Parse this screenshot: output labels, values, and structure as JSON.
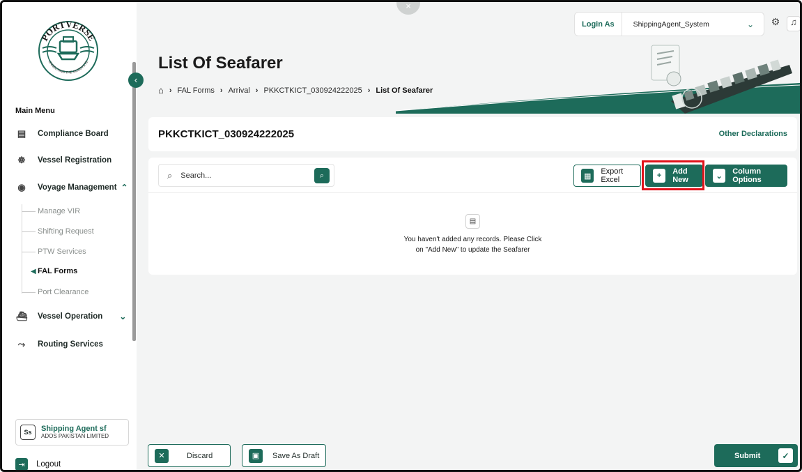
{
  "app": {
    "logo_text": "PORTVERSE",
    "logo_tagline": "CONNECTING THE ECOSYSTEM"
  },
  "colors": {
    "brand": "#1d6b5a",
    "highlight": "#e1131b",
    "background": "#f3f4f4"
  },
  "topbar": {
    "login_label": "Login As",
    "login_value": "ShippingAgent_System",
    "icons": [
      "chevron-down-icon",
      "gear-icon",
      "bell-icon"
    ]
  },
  "sidebar": {
    "main_menu_title": "Main Menu",
    "items": [
      {
        "label": "Compliance Board",
        "icon": "clipboard-icon"
      },
      {
        "label": "Vessel Registration",
        "icon": "ship-wheel-icon"
      },
      {
        "label": "Voyage Management",
        "icon": "compass-icon",
        "expanded": true
      },
      {
        "label": "Vessel Operation",
        "icon": "ship-icon",
        "expanded": false
      },
      {
        "label": "Routing Services",
        "icon": "route-icon"
      }
    ],
    "voyage_subitems": [
      {
        "label": "Manage VIR",
        "active": false
      },
      {
        "label": "Shifting Request",
        "active": false
      },
      {
        "label": "PTW Services",
        "active": false
      },
      {
        "label": "FAL Forms",
        "active": true
      },
      {
        "label": "Port Clearance",
        "active": false
      }
    ],
    "user": {
      "initials": "Ss",
      "name": "Shipping Agent sf",
      "org": "ADOS PAKISTAN LIMITED"
    },
    "logout_label": "Logout"
  },
  "header": {
    "title": "List Of Seafarer",
    "breadcrumb": [
      "FAL Forms",
      "Arrival",
      "PKKCTKICT_030924222025",
      "List Of Seafarer"
    ]
  },
  "declaration": {
    "id": "PKKCTKICT_030924222025",
    "other_label": "Other Declarations"
  },
  "toolbar": {
    "search_placeholder": "Search...",
    "export_label": "Export Excel",
    "add_new_label": "Add New",
    "column_options_label": "Column Options"
  },
  "empty_state": {
    "line1": "You haven't added any records. Please Click",
    "line2": "on \"Add New\" to update the Seafarer"
  },
  "footer": {
    "discard_label": "Discard",
    "save_draft_label": "Save As Draft",
    "submit_label": "Submit"
  }
}
